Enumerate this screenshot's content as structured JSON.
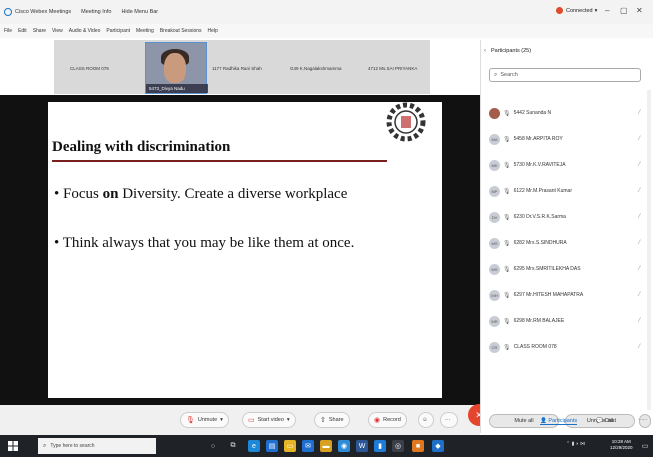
{
  "titlebar": {
    "items": [
      "Cisco Webex Meetings",
      "Meeting Info",
      "Hide Menu Bar"
    ],
    "status": "Connected"
  },
  "menubar": {
    "items": [
      "File",
      "Edit",
      "Share",
      "View",
      "Audio & Video",
      "Participant",
      "Meeting",
      "Breakout Sessions",
      "Help"
    ]
  },
  "video_strip": {
    "tiles": [
      "CLASS ROOM 078",
      "1177 Radhika Rani Shah",
      "G49 K.Nagalakshmamma",
      "4712 Ms.SAI PRIYANKA"
    ],
    "self_name": "5473_Divya Nadu"
  },
  "slide": {
    "title": "Dealing with discrimination",
    "bullet1_prefix": "•  Focus ",
    "bullet1_bold": "on",
    "bullet1_suffix": " Diversity. Create a diverse workplace",
    "bullet2": "• Think always that you may be like them at once."
  },
  "controls": {
    "unmute": "Unmute",
    "start_video": "Start video",
    "share": "Share",
    "record": "Record"
  },
  "panel": {
    "title": "Participants (25)",
    "search_placeholder": "Search",
    "participants": [
      "5442 Sunanda N",
      "5458 Mr.ARPITA ROY",
      "5730 Mr.K.V.RAVITEJA",
      "6122 Mr.M.Prasant Kumar",
      "6230 Dr.V.S.R.K.Sarma",
      "6282 Mrs.S.SINDHURA",
      "6295 Mrs.SMRITILEKHA DAS",
      "6297 Mr.HITESH MAHAPATRA",
      "6298 Mr.RM BALAJEE",
      "CLASS ROOM 078"
    ],
    "avatars": [
      "",
      "MA",
      "MK",
      "MP",
      "DV",
      "MS",
      "MS",
      "MH",
      "MR",
      "CR"
    ],
    "mute_all": "Mute all",
    "unmute_all": "Unmute all",
    "tab_participants": "Participants",
    "tab_chat": "Chat"
  },
  "taskbar": {
    "search_placeholder": "Type here to search",
    "time": "10:28 AM",
    "date": "12/29/2020"
  }
}
